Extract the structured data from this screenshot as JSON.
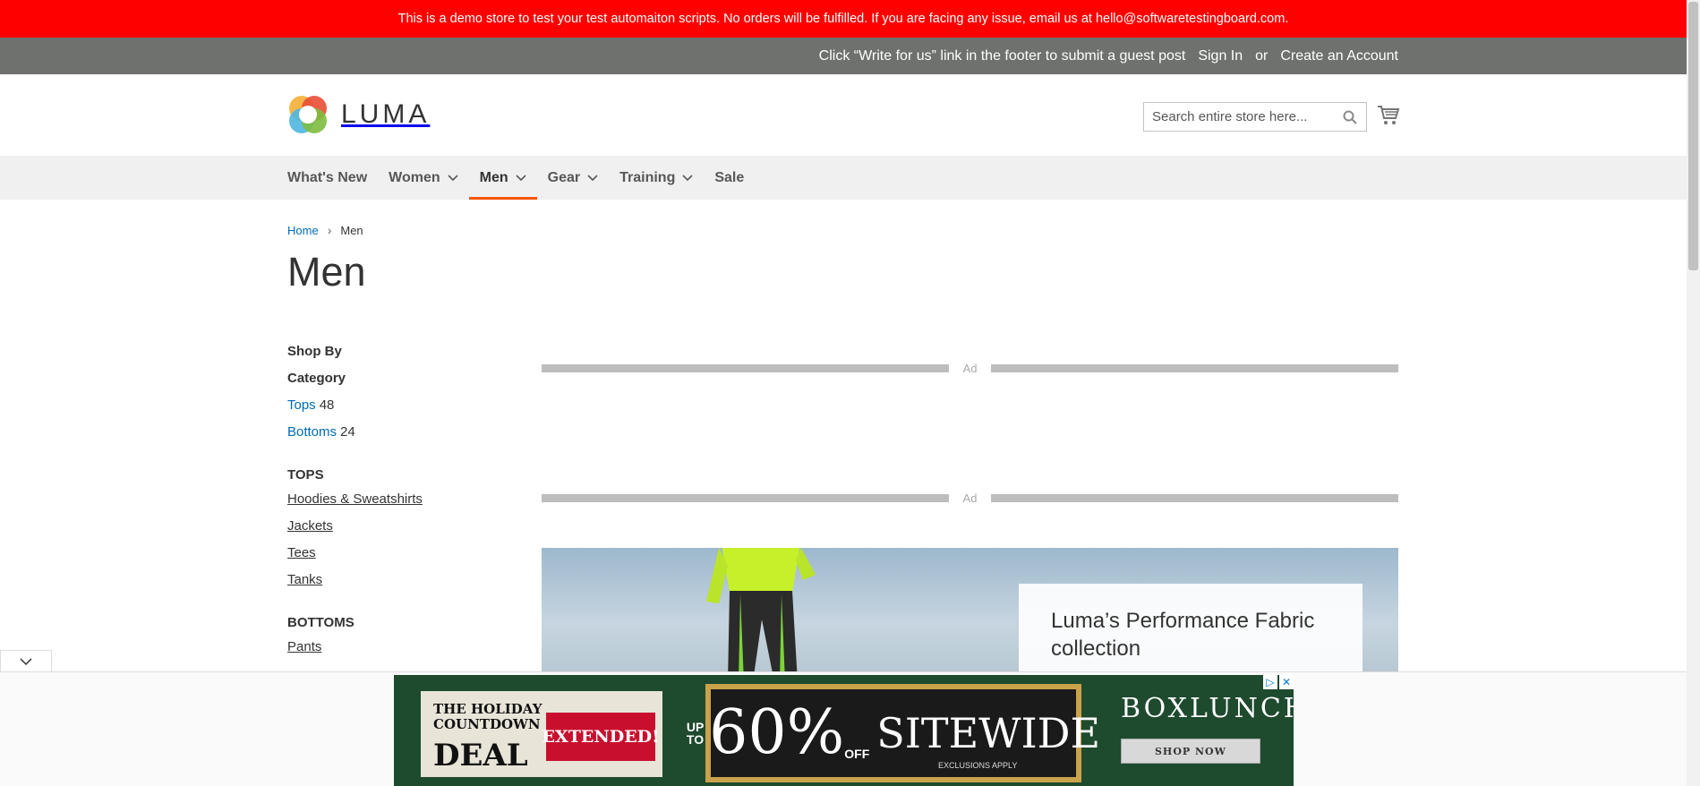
{
  "demo_notice": "This is a demo store to test your test automaiton scripts. No orders will be fulfilled. If you are facing any issue, email us at hello@softwaretestingboard.com.",
  "panel": {
    "guest_post": "Click “Write for us” link in the footer to submit a guest post",
    "sign_in": "Sign In",
    "or": "or",
    "create_account": "Create an Account"
  },
  "header": {
    "logo_text": "LUMA",
    "search_placeholder": "Search entire store here...",
    "colors": {
      "accent": "#ff5501",
      "link": "#006bb4",
      "demo_bar": "#ff0000"
    }
  },
  "nav": {
    "items": [
      {
        "label": "What's New",
        "dropdown": false,
        "active": false
      },
      {
        "label": "Women",
        "dropdown": true,
        "active": false
      },
      {
        "label": "Men",
        "dropdown": true,
        "active": true
      },
      {
        "label": "Gear",
        "dropdown": true,
        "active": false
      },
      {
        "label": "Training",
        "dropdown": true,
        "active": false
      },
      {
        "label": "Sale",
        "dropdown": false,
        "active": false
      }
    ]
  },
  "breadcrumbs": {
    "home": "Home",
    "separator": "›",
    "current": "Men"
  },
  "page_title": "Men",
  "sidebar": {
    "shop_by": "Shop By",
    "filter_title": "Category",
    "filters": [
      {
        "label": "Tops",
        "count": "48"
      },
      {
        "label": "Bottoms",
        "count": "24"
      }
    ],
    "groups": [
      {
        "title": "TOPS",
        "links": [
          "Hoodies & Sweatshirts",
          "Jackets",
          "Tees",
          "Tanks"
        ]
      },
      {
        "title": "BOTTOMS",
        "links": [
          "Pants"
        ]
      }
    ]
  },
  "ads": {
    "label": "Ad"
  },
  "hero": {
    "title": "Luma’s Performance Fabric collection"
  },
  "bottom_ad": {
    "left_line1": "THE HOLIDAY",
    "left_line2": "COUNTDOWN",
    "left_deal": "DEAL",
    "left_badge": "EXTENDED!",
    "up_to": "UP TO",
    "percent": "60%",
    "off": "OFF",
    "sitewide": "SITEWIDE",
    "exclusions": "EXCLUSIONS APPLY",
    "brand": "BOXLUNCH",
    "shop_now": "SHOP NOW"
  }
}
